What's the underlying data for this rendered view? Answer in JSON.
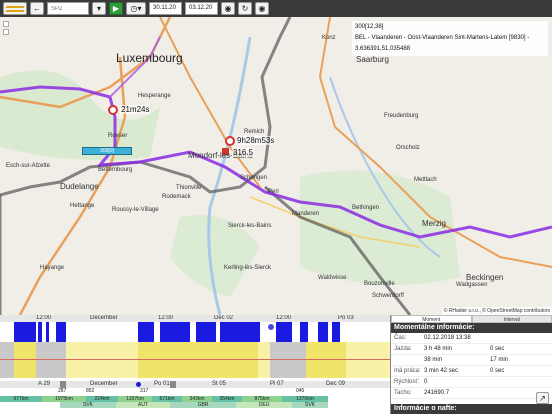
{
  "toolbar": {
    "spz_placeholder": "ŠPZ",
    "date_from": "30.11.20",
    "date_to": "03.12.20",
    "back_icon": "arrow-left-icon",
    "play_icon": "play-icon",
    "reload_icon": "refresh-icon"
  },
  "map": {
    "cities": [
      {
        "name": "Luxembourg",
        "size": "big"
      },
      {
        "name": "Saarburg",
        "size": "mid"
      },
      {
        "name": "Merzig",
        "size": "mid"
      },
      {
        "name": "Dudelange",
        "size": "mid"
      },
      {
        "name": "Bettembourg",
        "size": "small"
      },
      {
        "name": "Mondorf-les-Bains",
        "size": "mid"
      },
      {
        "name": "Thionville",
        "size": "small"
      },
      {
        "name": "Perl",
        "size": "small"
      },
      {
        "name": "Sierck-les-Bains",
        "size": "small"
      },
      {
        "name": "Manderen",
        "size": "small"
      },
      {
        "name": "Kerling-lès-Sierck",
        "size": "small"
      },
      {
        "name": "Waldwisse",
        "size": "small"
      },
      {
        "name": "Hettange",
        "size": "small"
      },
      {
        "name": "Roussy-le-Village",
        "size": "small"
      },
      {
        "name": "Bouzonville",
        "size": "small"
      },
      {
        "name": "Wadgassen",
        "size": "small"
      },
      {
        "name": "Beckingen",
        "size": "mid"
      },
      {
        "name": "Hayange",
        "size": "small"
      },
      {
        "name": "Rodemack",
        "size": "small"
      },
      {
        "name": "Schwerdorff",
        "size": "small"
      },
      {
        "name": "Bethingen",
        "size": "small"
      },
      {
        "name": "Mettlach",
        "size": "small"
      },
      {
        "name": "Remich",
        "size": "small"
      },
      {
        "name": "Schengen",
        "size": "small"
      },
      {
        "name": "Hesperange",
        "size": "small"
      },
      {
        "name": "Roeser",
        "size": "small"
      },
      {
        "name": "Esch-sur-Alzette",
        "size": "small"
      },
      {
        "name": "Konz",
        "size": "small"
      },
      {
        "name": "Freudenburg",
        "size": "small"
      },
      {
        "name": "Orscholz",
        "size": "small"
      }
    ],
    "marker1_label": "21m24s",
    "marker2_label": "9h28m53s",
    "marker3_label": "316.5",
    "position_tag": "300[0]",
    "tooltip_line1": "300[12,38]",
    "tooltip_line2": "BEL - Vlaanderen - Oost-Vlaanderen Sint-Martens-Latem [9830] -",
    "tooltip_line3": "3.636391,51.035488",
    "attribution": "© RHaider s.r.o., © OpenStreetMap contributors"
  },
  "chart": {
    "ruler_top": [
      "12:00",
      "December",
      "12:00",
      "Dec 02",
      "12:00",
      "Po 03"
    ],
    "ruler_bottom": [
      "A 29",
      "December",
      "Po 01",
      "St 05",
      "Pi 07",
      "Dec 09"
    ],
    "events": [
      "287",
      "852",
      "317",
      "045"
    ],
    "bands_km": [
      "677km",
      "1975km",
      "224km",
      "1337km",
      "671km",
      "343km",
      "354km",
      "875km",
      "1376km"
    ],
    "bands_country": [
      "SVK",
      "AUT",
      "GBR",
      "DEU",
      "SVK"
    ],
    "colors": {
      "active": "#1a1ae0",
      "band_a": "#66c2a5",
      "band_b": "#8fd18f",
      "yellow": "#f7f2a8"
    }
  },
  "panel": {
    "tab_moment": "Moment",
    "tab_interval": "Interval",
    "header": "Momentálne informácie:",
    "rows": [
      {
        "k": "Čas:",
        "v1": "02.12.2018 13:38",
        "v2": ""
      },
      {
        "k": "Jazda:",
        "v1": "3 h 48 min",
        "v2": "0 sec"
      },
      {
        "k": "",
        "v1": "38 min",
        "v2": "17 min"
      },
      {
        "k": "Iná práca:",
        "v1": "3 min 42 sec",
        "v2": "0 sec"
      },
      {
        "k": "Rýchlosť:",
        "v1": "0",
        "v2": ""
      },
      {
        "k": "Tacho:",
        "v1": "241690.7",
        "v2": ""
      }
    ],
    "footer": "Informácie o nafte:"
  }
}
